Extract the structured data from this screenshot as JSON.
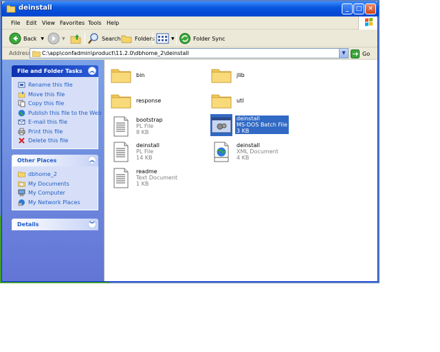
{
  "window": {
    "title": "deinstall",
    "minimize_glyph": "_",
    "maximize_glyph": "□",
    "close_glyph": "✕"
  },
  "menu": [
    "File",
    "Edit",
    "View",
    "Favorites",
    "Tools",
    "Help"
  ],
  "toolbar": {
    "back_label": "Back",
    "search_label": "Search",
    "folders_label": "Folders",
    "folder_sync_label": "Folder Sync"
  },
  "address": {
    "label": "Address",
    "path": "C:\\app\\confadmin\\product\\11.2.0\\dbhome_2\\deinstall",
    "go_label": "Go"
  },
  "file_tasks": {
    "title": "File and Folder Tasks",
    "items": [
      {
        "label": "Rename this file",
        "icon": "rename-icon"
      },
      {
        "label": "Move this file",
        "icon": "move-icon"
      },
      {
        "label": "Copy this file",
        "icon": "copy-icon"
      },
      {
        "label": "Publish this file to the Web",
        "icon": "globe-icon"
      },
      {
        "label": "E-mail this file",
        "icon": "email-icon"
      },
      {
        "label": "Print this file",
        "icon": "printer-icon"
      },
      {
        "label": "Delete this file",
        "icon": "delete-icon"
      }
    ]
  },
  "other_places": {
    "title": "Other Places",
    "items": [
      {
        "label": "dbhome_2",
        "icon": "folder-icon"
      },
      {
        "label": "My Documents",
        "icon": "documents-icon"
      },
      {
        "label": "My Computer",
        "icon": "computer-icon"
      },
      {
        "label": "My Network Places",
        "icon": "network-icon"
      }
    ]
  },
  "details": {
    "title": "Details"
  },
  "files": [
    {
      "name": "bin",
      "type": "",
      "size": "",
      "icon": "folder-icon"
    },
    {
      "name": "jlib",
      "type": "",
      "size": "",
      "icon": "folder-icon"
    },
    {
      "name": "response",
      "type": "",
      "size": "",
      "icon": "folder-icon"
    },
    {
      "name": "utl",
      "type": "",
      "size": "",
      "icon": "folder-icon"
    },
    {
      "name": "bootstrap",
      "type": "PL File",
      "size": "8 KB",
      "icon": "text-file-icon"
    },
    {
      "name": "deinstall",
      "type": "MS-DOS Batch File",
      "size": "3 KB",
      "icon": "batch-file-icon",
      "selected": true
    },
    {
      "name": "deinstall",
      "type": "PL File",
      "size": "14 KB",
      "icon": "text-file-icon"
    },
    {
      "name": "deinstall",
      "type": "XML Document",
      "size": "4 KB",
      "icon": "xml-file-icon"
    },
    {
      "name": "readme",
      "type": "Text Document",
      "size": "1 KB",
      "icon": "text-file-icon"
    }
  ],
  "colors": {
    "titlebar": "#0a58e0",
    "taskpane": "#6f8ddf",
    "link": "#215dc6",
    "selection": "#316ac5"
  }
}
